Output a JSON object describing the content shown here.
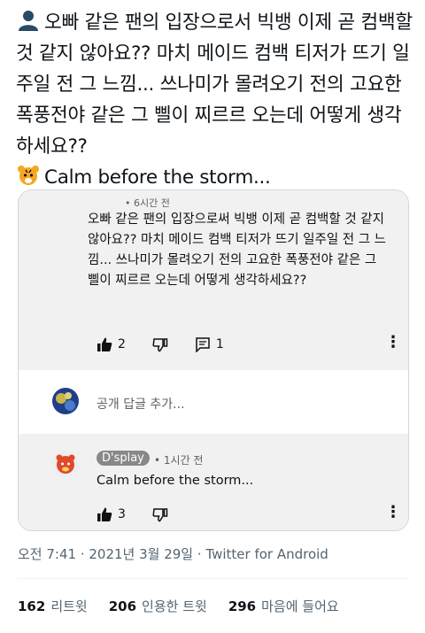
{
  "tweet": {
    "text": "오빠 같은 팬의 입장으로서 빅뱅 이제 곧 컴백할 것 같지 않아요?? 마치 메이드 컴백 티저가 뜨기 일주일 전 그 느낌... 쓰나미가 몰려오기 전의 고요한 폭풍전야 같은 그 삘이 찌르르 오는데 어떻게 생각하세요??",
    "text2": "Calm before the storm...",
    "timestamp": "오전 7:41 · 2021년 3월 29일 · Twitter for Android"
  },
  "card": {
    "comment": {
      "time": "• 6시간 전",
      "text": "오빠 같은 팬의 입장으로써 빅뱅 이제 곧 컴백할 것 같지 않아요?? 마치 메이드 컴백 티저가 뜨기 일주일 전 그 느낌... 쓰나미가 몰려오기 전의 고요한 폭풍전야 같은 그 삘이 찌르르 오는데 어떻게 생각하세요??",
      "likes": "2",
      "replies": "1"
    },
    "add_reply_placeholder": "공개 답글 추가...",
    "reply": {
      "author": "D'splay",
      "time": "• 1시간 전",
      "text": "Calm before the storm...",
      "likes": "3"
    }
  },
  "stats": {
    "retweets": "162",
    "retweets_label": "리트윗",
    "quotes": "206",
    "quotes_label": "인용한 트윗",
    "likes": "296",
    "likes_label": "마음에 들어요"
  },
  "colors": {
    "text": "#0f1419",
    "secondary": "#536471",
    "card_bg": "#f1f1f1",
    "border": "#cfd9de"
  }
}
